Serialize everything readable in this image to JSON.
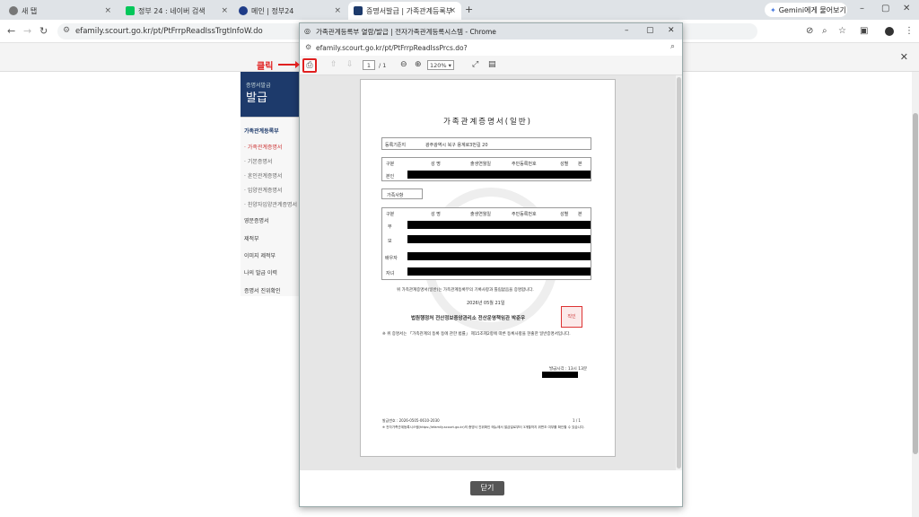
{
  "tabs": [
    {
      "title": "새 탭",
      "icon": "chrome-icon",
      "color": "#777777"
    },
    {
      "title": "정부 24 : 네이버 검색",
      "icon": "naver-icon",
      "color": "#03c75a"
    },
    {
      "title": "메인 | 정부24",
      "icon": "gov24-icon",
      "color": "#1f3c88"
    },
    {
      "title": "증명서발급 | 가족관계등록부",
      "icon": "court-icon",
      "color": "#1d3a6b"
    }
  ],
  "new_tab": "+",
  "gemini_label": "Gemini에게 물어보기",
  "address": "efamily.scourt.go.kr/pt/PtFrrpReadIssTrgtInfoW.do",
  "sidebar": {
    "banner_small": "증명서발급",
    "banner_big": "발급",
    "section": "가족관계등록부",
    "items": [
      "· 가족관계증명서",
      "· 기본증명서",
      "· 혼인관계증명서",
      "· 입양관계증명서",
      "· 친양자입양관계증명서"
    ],
    "menus": [
      "영문증명서",
      "제적부",
      "이미지 제적부",
      "나의 발급 이력",
      "증명서 진위확인"
    ]
  },
  "popup": {
    "title": "가족관계등록부 열람/발급 | 전자가족관계등록시스템 - Chrome",
    "url": "efamily.scourt.go.kr/pt/PtFrrpReadIssPrcs.do?",
    "page_current": "1",
    "page_total": "/ 1",
    "zoom": "120%",
    "close_button": "닫기"
  },
  "doc": {
    "title": "가족관계증명서(일반)",
    "reg_label": "등록기준지",
    "reg_value": "광주광역시 북구 용계로3번길 20",
    "headers": [
      "구분",
      "성  명",
      "출생연월일",
      "주민등록번호",
      "성별",
      "본"
    ],
    "self_label": "본인",
    "family_label": "가족사항",
    "family_rows": [
      "부",
      "모",
      "배우자",
      "자녀"
    ],
    "statement": "위 가족관계증명서(일반)는 가족관계등록부의 기록사항과 틀림없음을 증명합니다.",
    "date": "2026년 05월 21일",
    "issuer": "법원행정처 전산정보중앙관리소 전산운영책임관 박준우",
    "seal": "직인",
    "note": "※ 위 증명서는 「가족관계의 등록 등에 관한 법률」 제15조제2항에 따른 등록사항을 현출한 일반증명서입니다.",
    "applicant_label": "발급시각 : 13시 13분",
    "issue_no_label": "발급번호 : 2026-0505-0610-2030",
    "page_footer": "1 / 1",
    "footer_note": "※ 전자가족관계등록시스템(https://efamily.scourt.go.kr)의 증명서 진위확인 메뉴에서 발급일로부터 3개월까지 위변조 여부를 확인할 수 있습니다."
  },
  "annotation": "클릭"
}
